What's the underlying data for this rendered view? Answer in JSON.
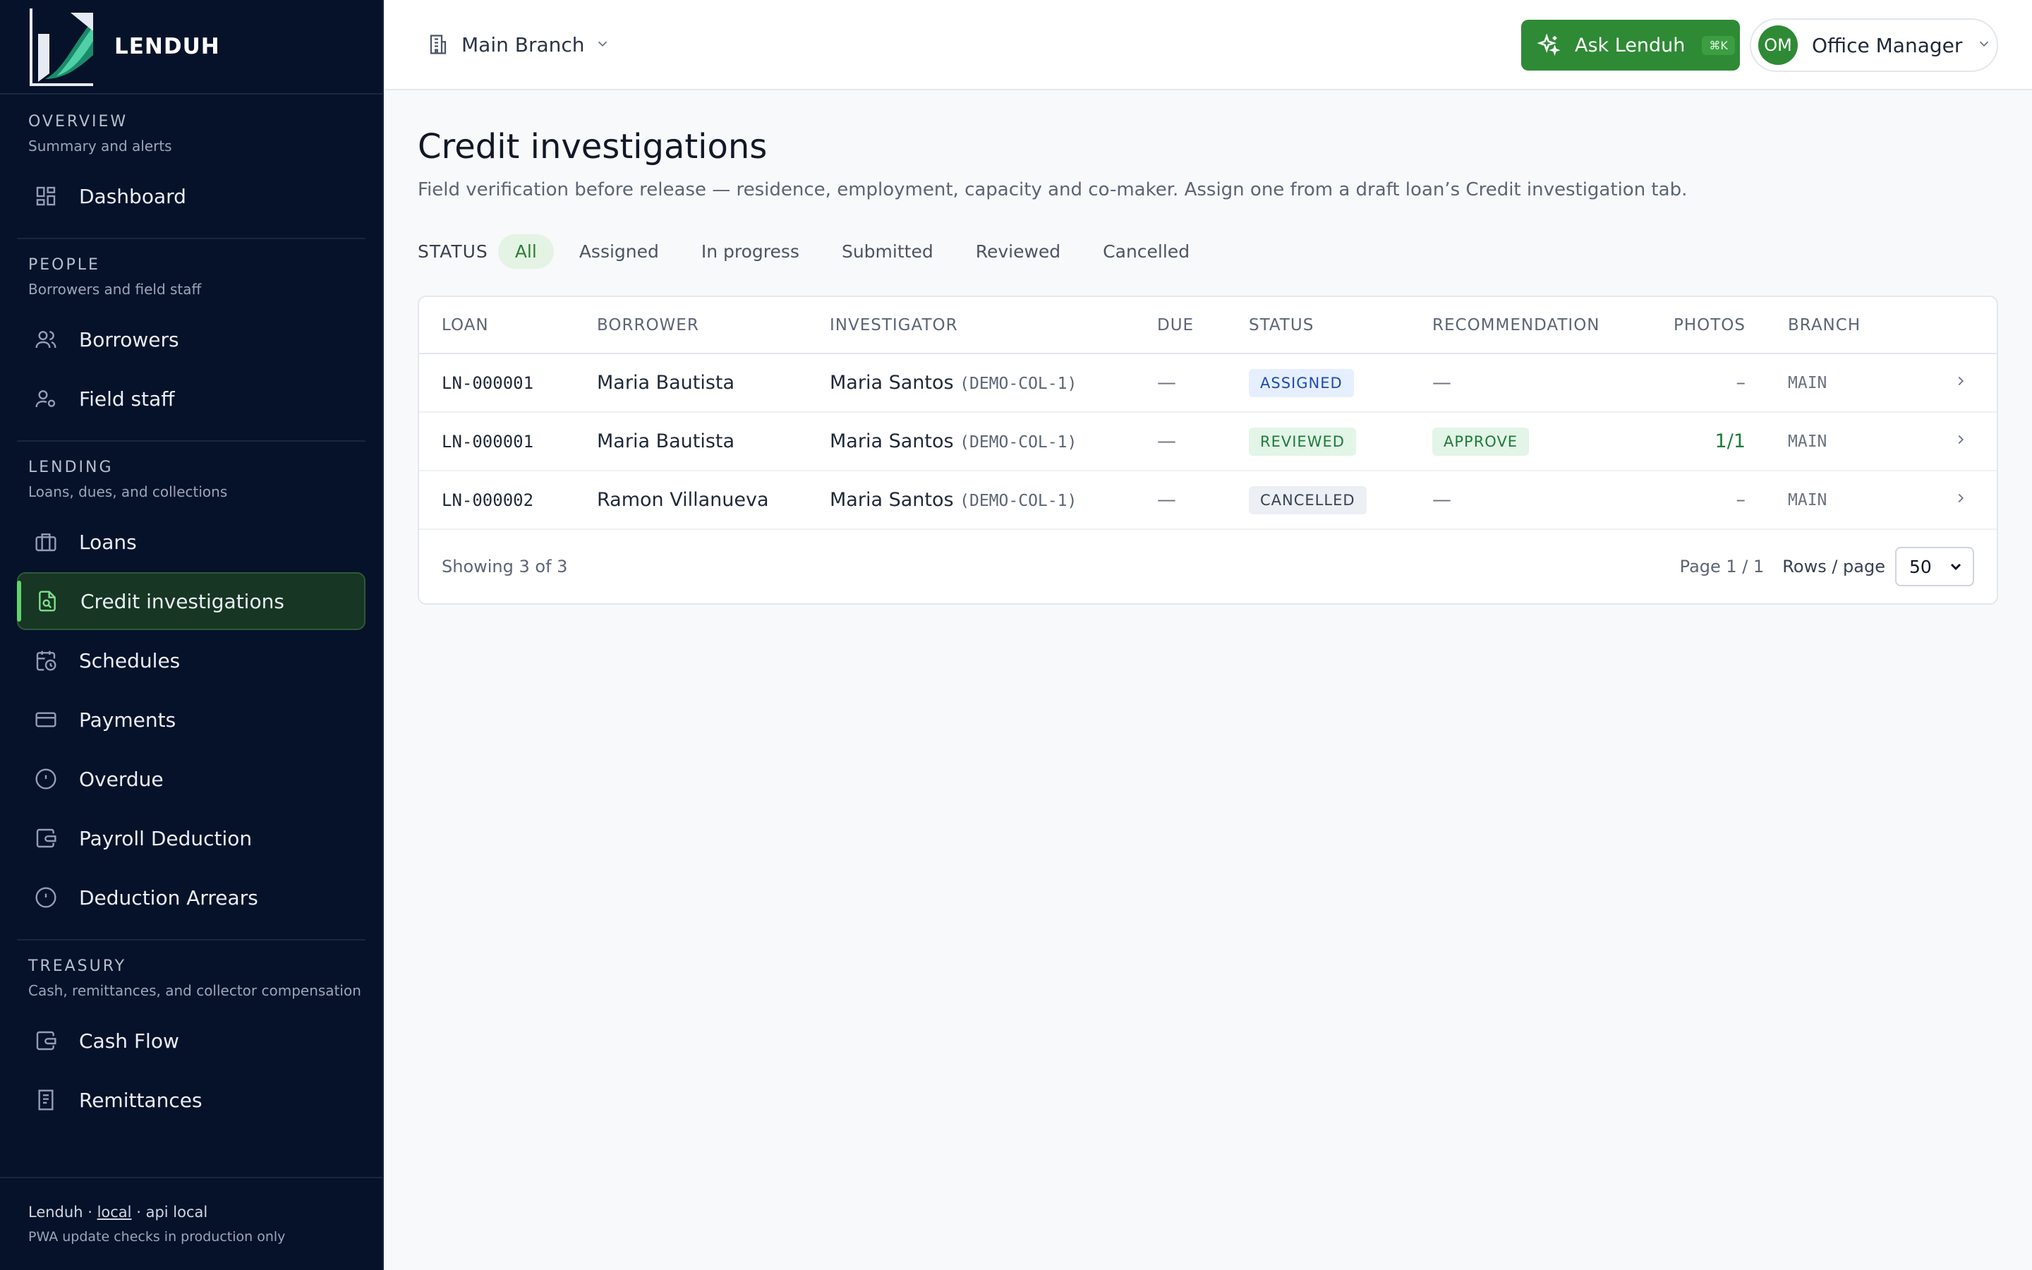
{
  "app": {
    "name": "LENDUH"
  },
  "sidebar": {
    "sections": [
      {
        "title": "OVERVIEW",
        "subtitle": "Summary and alerts",
        "items": [
          {
            "label": "Dashboard",
            "icon": "grid-icon"
          }
        ]
      },
      {
        "title": "PEOPLE",
        "subtitle": "Borrowers and field staff",
        "items": [
          {
            "label": "Borrowers",
            "icon": "users-icon"
          },
          {
            "label": "Field staff",
            "icon": "user-cog-icon"
          }
        ]
      },
      {
        "title": "LENDING",
        "subtitle": "Loans, dues, and collections",
        "items": [
          {
            "label": "Loans",
            "icon": "briefcase-icon"
          },
          {
            "label": "Credit investigations",
            "icon": "file-search-icon",
            "active": true
          },
          {
            "label": "Schedules",
            "icon": "calendar-clock-icon"
          },
          {
            "label": "Payments",
            "icon": "credit-card-icon"
          },
          {
            "label": "Overdue",
            "icon": "alert-circle-icon"
          },
          {
            "label": "Payroll Deduction",
            "icon": "wallet-icon"
          },
          {
            "label": "Deduction Arrears",
            "icon": "alert-circle-icon"
          }
        ]
      },
      {
        "title": "TREASURY",
        "subtitle": "Cash, remittances, and collector compensation",
        "items": [
          {
            "label": "Cash Flow",
            "icon": "wallet-icon"
          },
          {
            "label": "Remittances",
            "icon": "receipt-icon"
          }
        ]
      }
    ],
    "footer": {
      "app": "Lenduh",
      "env": "local",
      "api": "api local",
      "separator": "·",
      "note": "PWA update checks in production only"
    }
  },
  "header": {
    "branch": "Main Branch",
    "ask_label": "Ask Lenduh",
    "ask_shortcut": "⌘K",
    "user_initials": "OM",
    "user_role": "Office Manager"
  },
  "page": {
    "title": "Credit investigations",
    "description": "Field verification before release — residence, employment, capacity and co-maker. Assign one from a draft loan’s Credit investigation tab."
  },
  "filters": {
    "label": "STATUS",
    "options": [
      "All",
      "Assigned",
      "In progress",
      "Submitted",
      "Reviewed",
      "Cancelled"
    ],
    "selected": "All"
  },
  "table": {
    "columns": [
      "LOAN",
      "BORROWER",
      "INVESTIGATOR",
      "DUE",
      "STATUS",
      "RECOMMENDATION",
      "PHOTOS",
      "BRANCH"
    ],
    "rows": [
      {
        "loan": "LN-000001",
        "borrower": "Maria Bautista",
        "investigator": "Maria Santos",
        "investigator_code": "(DEMO-COL-1)",
        "due": "—",
        "status": "ASSIGNED",
        "recommendation": "—",
        "photos": "–",
        "branch": "MAIN"
      },
      {
        "loan": "LN-000001",
        "borrower": "Maria Bautista",
        "investigator": "Maria Santos",
        "investigator_code": "(DEMO-COL-1)",
        "due": "—",
        "status": "REVIEWED",
        "recommendation": "APPROVE",
        "photos": "1/1",
        "branch": "MAIN"
      },
      {
        "loan": "LN-000002",
        "borrower": "Ramon Villanueva",
        "investigator": "Maria Santos",
        "investigator_code": "(DEMO-COL-1)",
        "due": "—",
        "status": "CANCELLED",
        "recommendation": "—",
        "photos": "–",
        "branch": "MAIN"
      }
    ],
    "footer": {
      "showing": "Showing 3 of 3",
      "page": "Page 1 / 1",
      "rows_label": "Rows / page",
      "rows_value": "50"
    }
  },
  "colors": {
    "sidebar_bg": "#061229",
    "accent": "#2e8a35",
    "active_item": "#173623"
  }
}
